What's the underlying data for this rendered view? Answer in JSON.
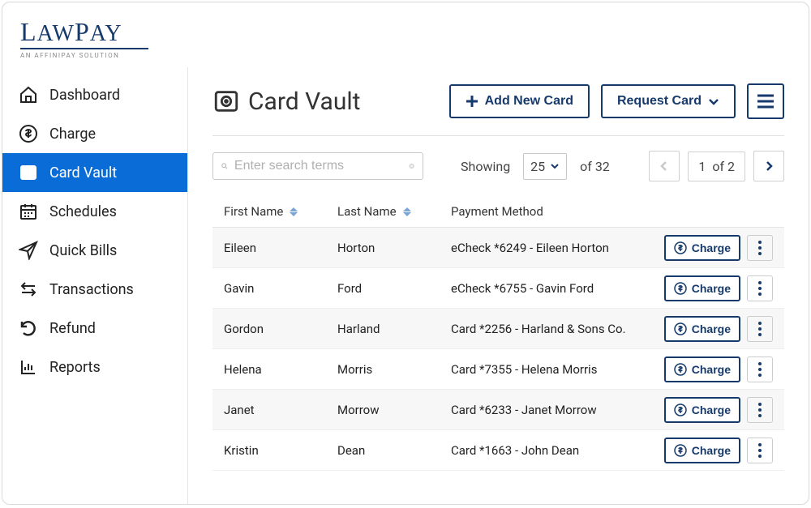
{
  "brand": {
    "name": "LAWPAY",
    "tagline": "AN AFFINIPAY SOLUTION"
  },
  "sidebar": {
    "items": [
      {
        "label": "Dashboard"
      },
      {
        "label": "Charge"
      },
      {
        "label": "Card Vault"
      },
      {
        "label": "Schedules"
      },
      {
        "label": "Quick Bills"
      },
      {
        "label": "Transactions"
      },
      {
        "label": "Refund"
      },
      {
        "label": "Reports"
      }
    ]
  },
  "page": {
    "title": "Card Vault",
    "add_label": "Add New Card",
    "request_label": "Request Card"
  },
  "search": {
    "placeholder": "Enter search terms"
  },
  "paging": {
    "showing_label": "Showing",
    "page_size": "25",
    "of_total": "of 32",
    "current_page": "1",
    "of_pages": "of 2"
  },
  "table": {
    "headers": {
      "first": "First Name",
      "last": "Last Name",
      "pm": "Payment Method"
    },
    "charge_label": "Charge",
    "rows": [
      {
        "first": "Eileen",
        "last": "Horton",
        "pm": "eCheck *6249 - Eileen Horton"
      },
      {
        "first": "Gavin",
        "last": "Ford",
        "pm": "eCheck *6755 - Gavin Ford"
      },
      {
        "first": "Gordon",
        "last": "Harland",
        "pm": "Card *2256 - Harland & Sons Co."
      },
      {
        "first": "Helena",
        "last": "Morris",
        "pm": "Card *7355 - Helena Morris"
      },
      {
        "first": "Janet",
        "last": "Morrow",
        "pm": "Card *6233 - Janet Morrow"
      },
      {
        "first": "Kristin",
        "last": "Dean",
        "pm": "Card *1663 - John Dean"
      }
    ]
  }
}
